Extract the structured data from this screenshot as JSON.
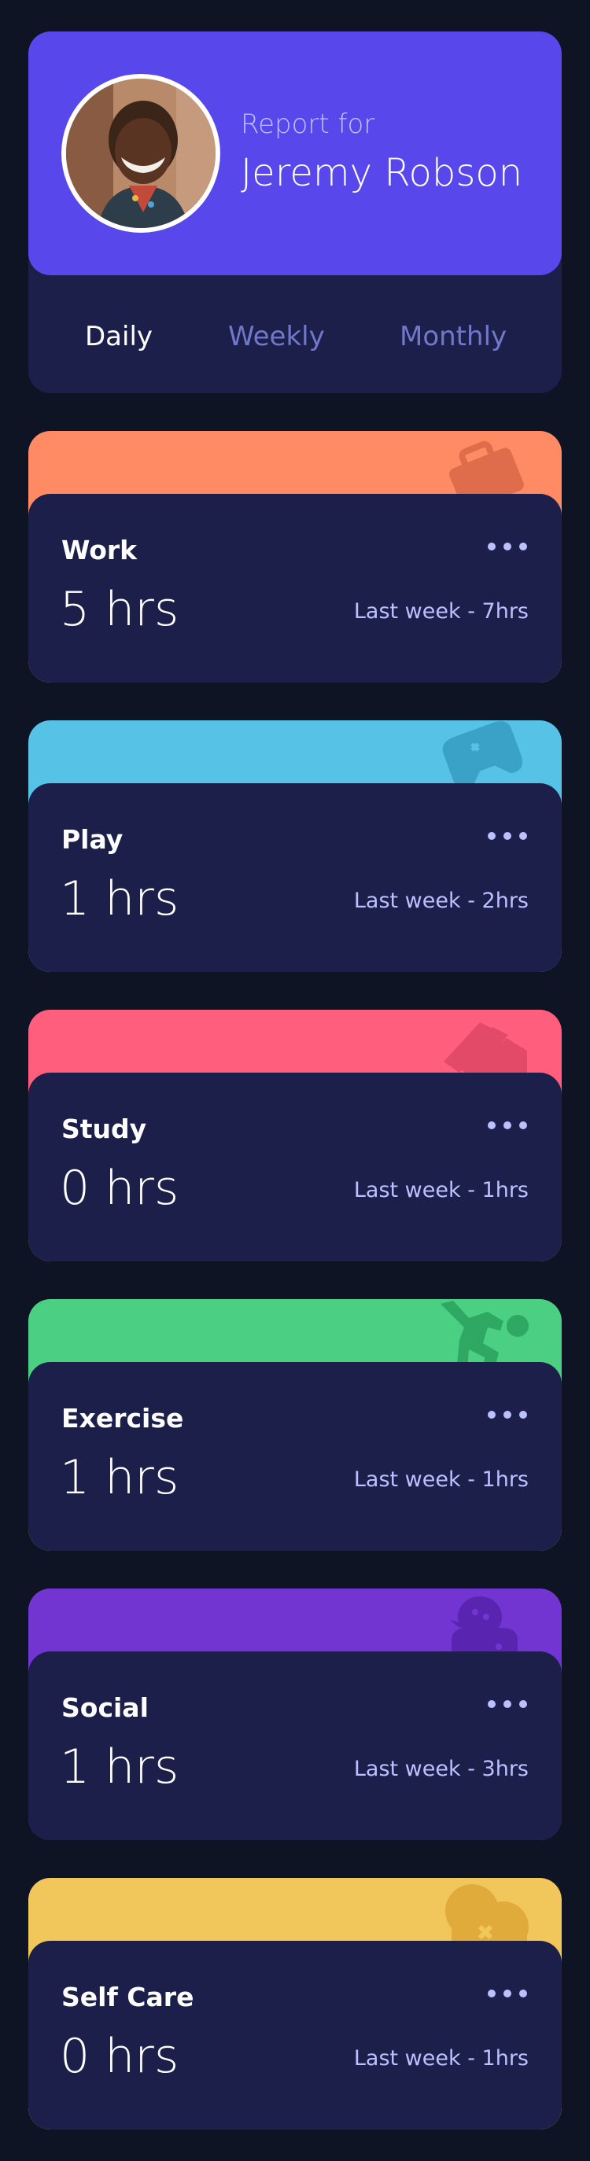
{
  "profile": {
    "report_for": "Report for",
    "name": "Jeremy Robson",
    "avatar": "profile-photo"
  },
  "tabs": [
    {
      "label": "Daily",
      "active": true
    },
    {
      "label": "Weekly",
      "active": false
    },
    {
      "label": "Monthly",
      "active": false
    }
  ],
  "activities": [
    {
      "title": "Work",
      "hours": "5 hrs",
      "last_week": "Last week - 7hrs",
      "color": "#ff8b64",
      "icon": "briefcase-icon"
    },
    {
      "title": "Play",
      "hours": "1 hrs",
      "last_week": "Last week - 2hrs",
      "color": "#55c2e6",
      "icon": "game-controller-icon"
    },
    {
      "title": "Study",
      "hours": "0 hrs",
      "last_week": "Last week - 1hrs",
      "color": "#ff5e7d",
      "icon": "book-icon"
    },
    {
      "title": "Exercise",
      "hours": "1 hrs",
      "last_week": "Last week - 1hrs",
      "color": "#4bcf82",
      "icon": "running-figure-icon"
    },
    {
      "title": "Social",
      "hours": "1 hrs",
      "last_week": "Last week - 3hrs",
      "color": "#7335d2",
      "icon": "chat-bubble-icon"
    },
    {
      "title": "Self Care",
      "hours": "0 hrs",
      "last_week": "Last week - 1hrs",
      "color": "#f1c75b",
      "icon": "heart-icon"
    }
  ],
  "theme": {
    "background": "#0e1424",
    "card": "#1c1f4a",
    "accent": "#5847eb",
    "muted_text": "#bbc0ff"
  }
}
